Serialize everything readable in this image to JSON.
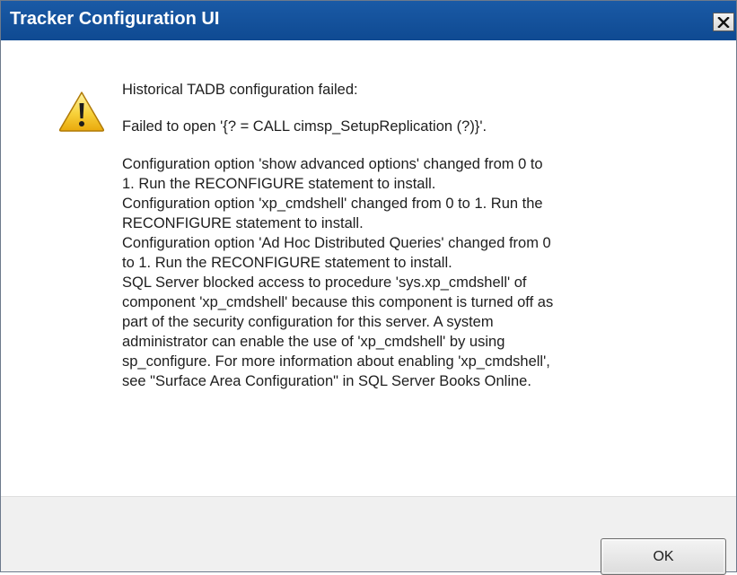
{
  "window": {
    "title": "Tracker Configuration UI"
  },
  "message": {
    "heading": "Historical TADB configuration failed:",
    "failed": "Failed to open '{? = CALL cimsp_SetupReplication (?)}'.",
    "details": [
      "Configuration option 'show advanced options' changed from 0 to",
      "1. Run the RECONFIGURE statement to install.",
      "Configuration option 'xp_cmdshell' changed from 0 to 1. Run the",
      "RECONFIGURE statement to install.",
      "Configuration option 'Ad Hoc Distributed Queries' changed from 0",
      "to 1. Run the RECONFIGURE statement to install.",
      "SQL Server blocked access to procedure 'sys.xp_cmdshell' of",
      "component 'xp_cmdshell' because this component is turned off as",
      "part of the security configuration for this server. A system",
      "administrator can enable the use of 'xp_cmdshell' by using",
      "sp_configure. For more information about enabling 'xp_cmdshell',",
      "see \"Surface Area Configuration\" in SQL Server Books Online."
    ]
  },
  "buttons": {
    "ok_label": "OK"
  },
  "icons": {
    "warning": "warning-icon",
    "close": "close-icon"
  }
}
